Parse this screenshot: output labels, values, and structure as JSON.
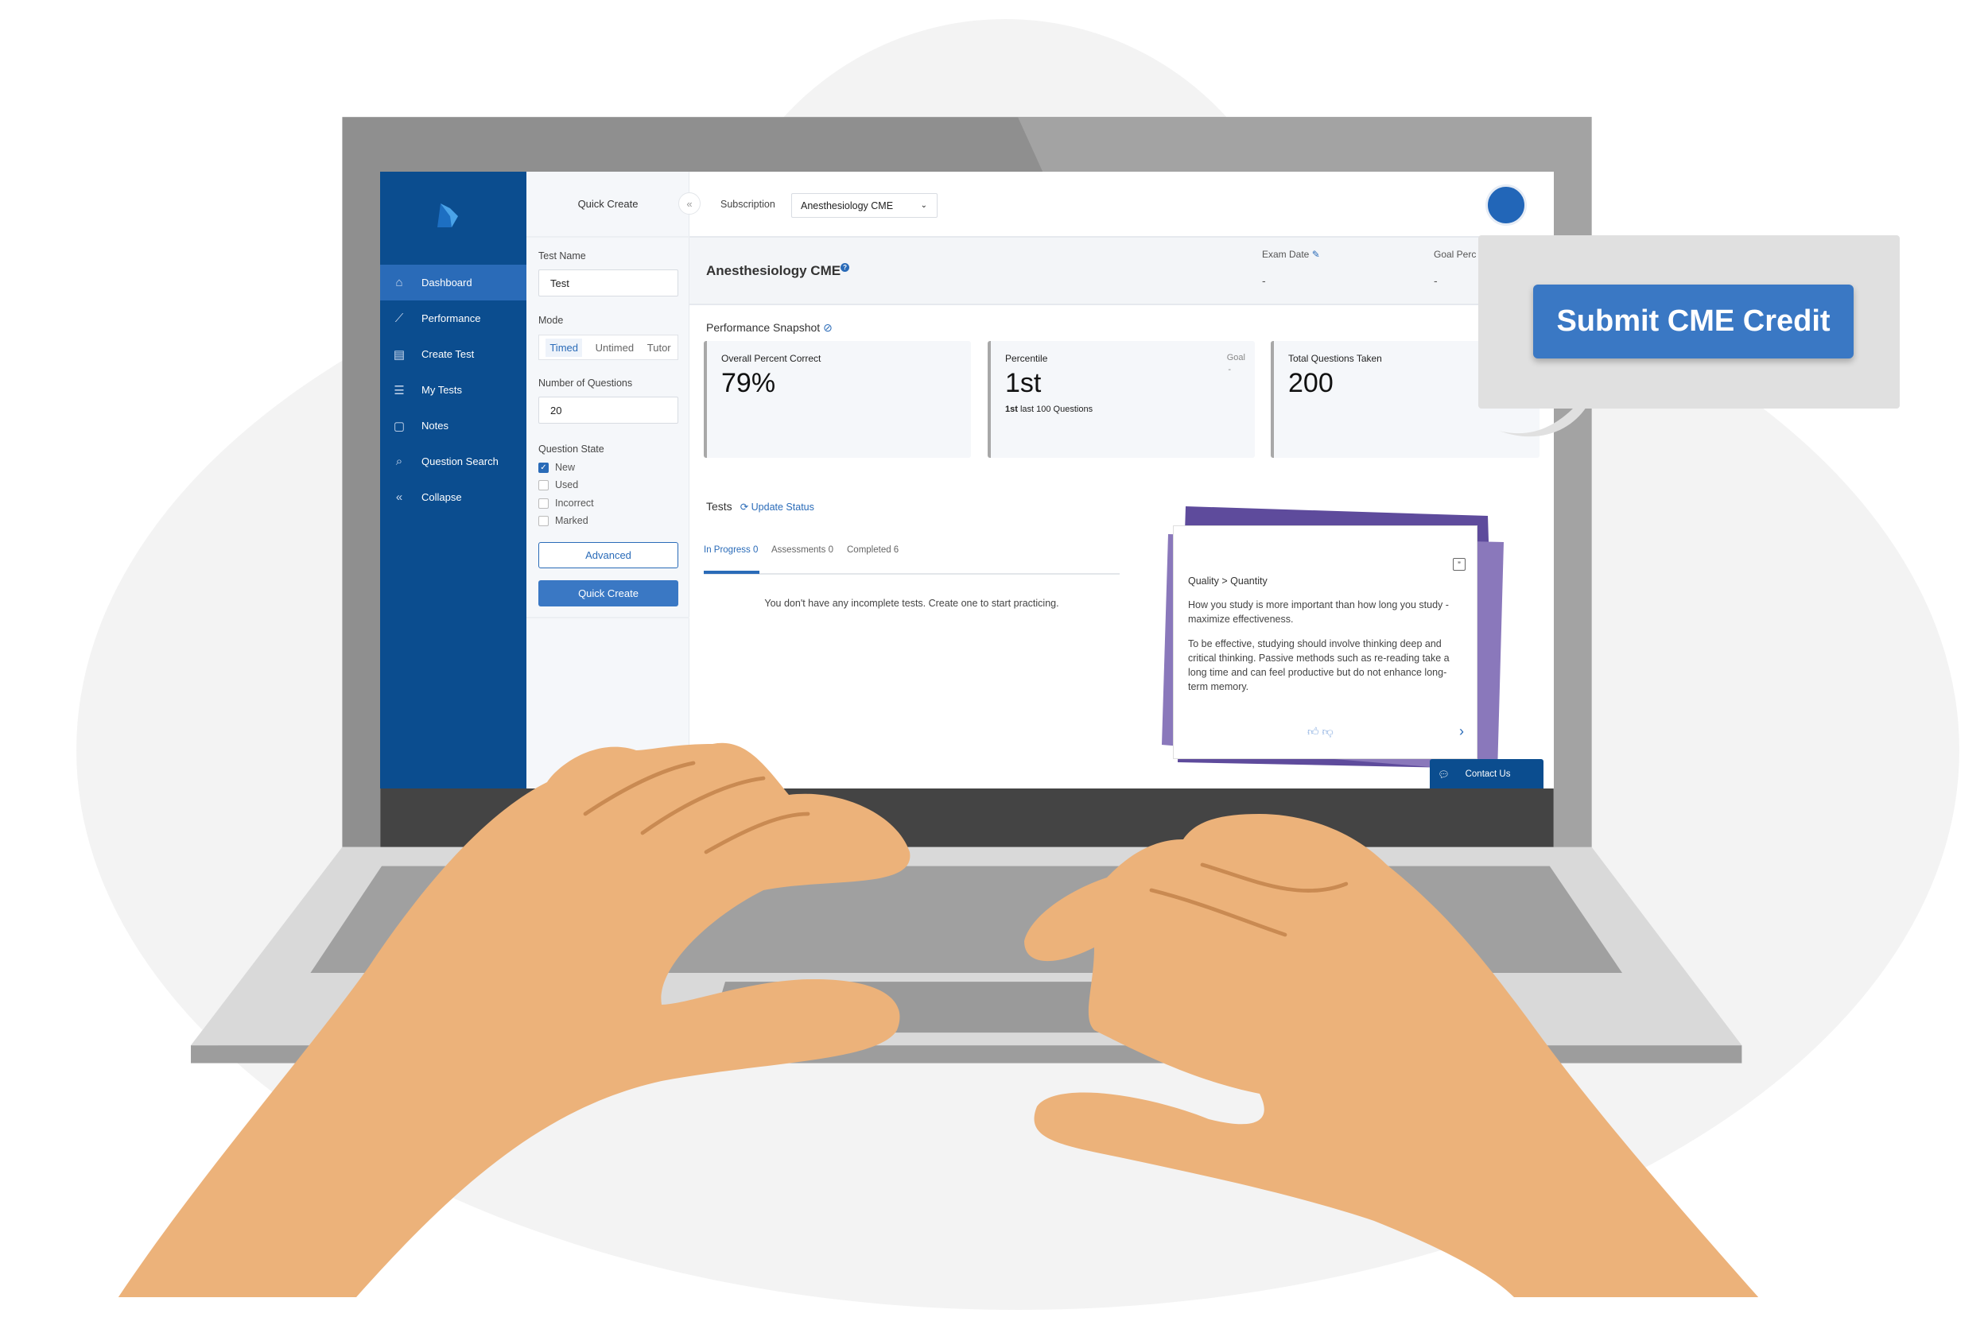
{
  "callout": {
    "button_label": "Submit CME Credit",
    "color": "#3a78c4"
  },
  "colors": {
    "sidebar": "#0b4d8f",
    "accent": "#2a6bb8",
    "skin": "#ecb27a",
    "quote_purple": "#7b65b0"
  },
  "sidebar": {
    "logo": "logo-icon",
    "items": [
      {
        "label": "Dashboard",
        "icon": "home-icon",
        "active": true
      },
      {
        "label": "Performance",
        "icon": "chart-icon"
      },
      {
        "label": "Create Test",
        "icon": "clipboard-icon"
      },
      {
        "label": "My Tests",
        "icon": "list-icon"
      },
      {
        "label": "Notes",
        "icon": "note-icon"
      },
      {
        "label": "Question Search",
        "icon": "search-icon"
      },
      {
        "label": "Collapse",
        "icon": "chevrons-left-icon"
      }
    ]
  },
  "quick_create": {
    "title": "Quick Create",
    "test_name_label": "Test Name",
    "test_name_value": "Test",
    "mode_label": "Mode",
    "modes": [
      "Timed",
      "Untimed",
      "Tutor"
    ],
    "mode_selected": "Timed",
    "num_questions_label": "Number of Questions",
    "num_questions_value": "20",
    "question_state_label": "Question State",
    "states": [
      {
        "label": "New",
        "checked": true
      },
      {
        "label": "Used",
        "checked": false
      },
      {
        "label": "Incorrect",
        "checked": false
      },
      {
        "label": "Marked",
        "checked": false
      }
    ],
    "advanced_label": "Advanced",
    "quick_create_label": "Quick Create"
  },
  "topbar": {
    "subscription_label": "Subscription",
    "subscription_value": "Anesthesiology CME"
  },
  "banner": {
    "title": "Anesthesiology CME",
    "exam_date_label": "Exam Date",
    "exam_date_value": "-",
    "goal_label": "Goal Perc",
    "goal_value": "-"
  },
  "snapshot": {
    "title": "Performance Snapshot",
    "cards": [
      {
        "label": "Overall Percent Correct",
        "value": "79%"
      },
      {
        "label": "Percentile",
        "value": "1st",
        "goal_label": "Goal",
        "goal_value": "-",
        "sub_bold": "1st",
        "sub": "last 100 Questions"
      },
      {
        "label": "Total Questions Taken",
        "value": "200"
      }
    ]
  },
  "tests": {
    "title": "Tests",
    "update_label": "Update Status",
    "tabs": [
      {
        "label": "In Progress 0",
        "active": true
      },
      {
        "label": "Assessments 0"
      },
      {
        "label": "Completed 6"
      }
    ],
    "empty_message": "You don't have any incomplete tests. Create one to start practicing."
  },
  "quote": {
    "title": "Quality > Quantity",
    "p1": "How you study is more important than how long you study - maximize effectiveness.",
    "p2": "To be effective, studying should involve thinking deep and critical thinking. Passive methods such as re-reading take a long time and can feel productive but do not enhance long-term memory."
  },
  "contact": {
    "label": "Contact Us"
  }
}
